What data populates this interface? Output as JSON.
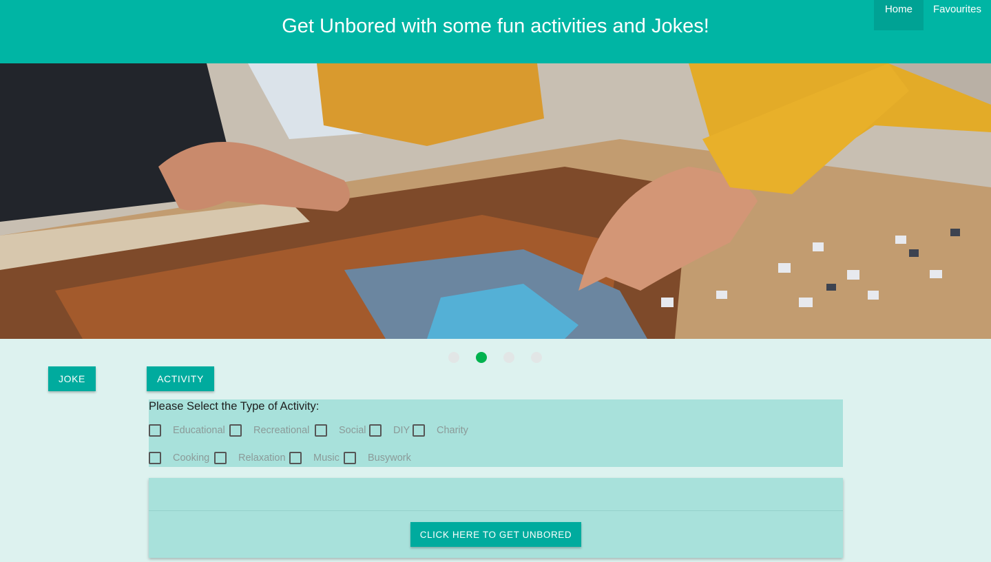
{
  "header": {
    "title": "Get Unbored with some fun activities and Jokes!",
    "nav": [
      {
        "label": "Home",
        "active": true
      },
      {
        "label": "Favourites",
        "active": false
      }
    ]
  },
  "hero": {
    "image": "puzzle-hands-photo",
    "carousel": {
      "count": 4,
      "active_index": 1
    }
  },
  "buttons": {
    "joke": "Joke",
    "activity": "Activity"
  },
  "activity_panel": {
    "title": "Please Select the Type of Activity:",
    "row1": [
      "Educational",
      "Recreational",
      "Social",
      "DIY",
      "Charity"
    ],
    "row2": [
      "Cooking",
      "Relaxation",
      "Music",
      "Busywork"
    ]
  },
  "result": {
    "button": "Click here to get unbored"
  },
  "colors": {
    "primary": "#00b5a4",
    "nav_active": "#00a294",
    "background": "#ddf2ef",
    "panel": "#a8e1db",
    "active_dot": "#00b24e"
  }
}
